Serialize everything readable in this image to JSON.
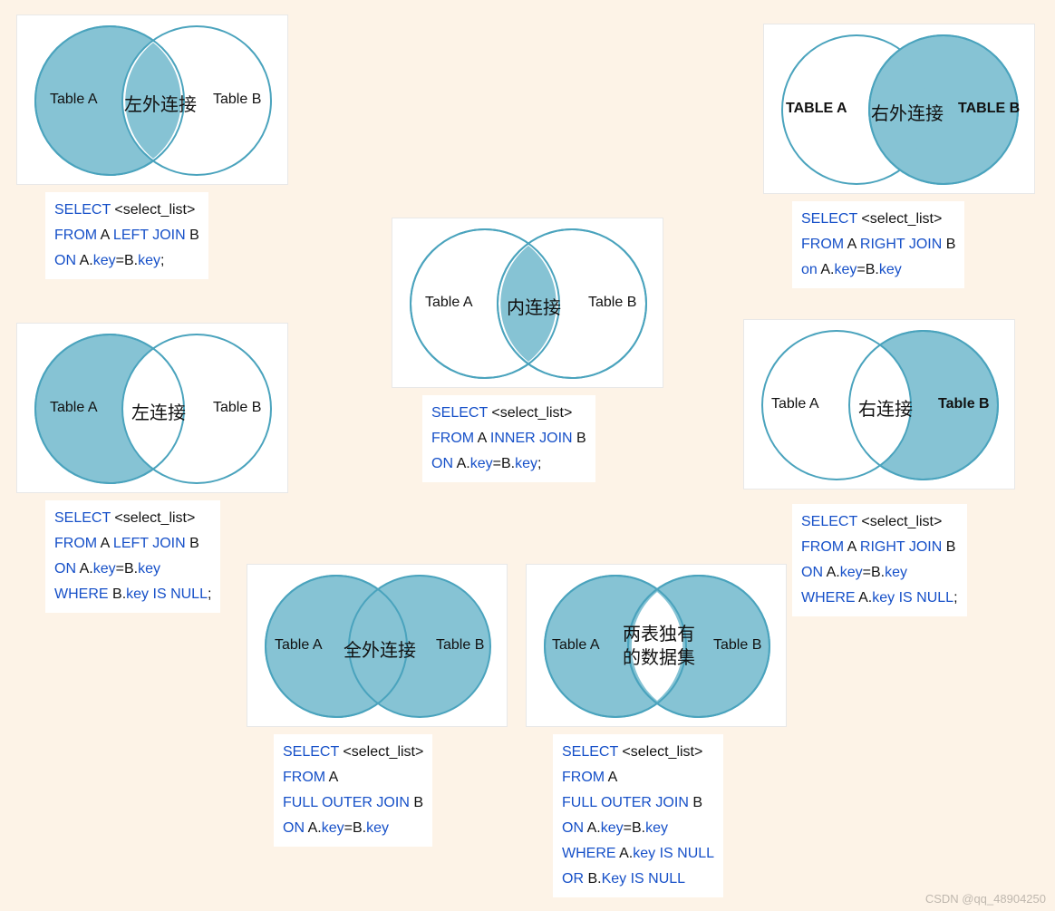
{
  "colors": {
    "fill": "#86c3d4",
    "stroke": "#4aa3bd",
    "white": "#ffffff"
  },
  "watermark": "CSDN @qq_48904250",
  "diagrams": {
    "left_outer": {
      "title": "左外连接",
      "labelA": "Table A",
      "labelB": "Table B",
      "sql": {
        "l1": {
          "select": "SELECT",
          "args": "<select_list>"
        },
        "l2": {
          "from": "FROM",
          "a": "A",
          "join": "LEFT JOIN",
          "b": "B"
        },
        "l3": {
          "on": "ON",
          "ak": "A.",
          "key1": "key",
          "eq": "=B.",
          "key2": "key",
          "semi": ";"
        }
      }
    },
    "right_outer": {
      "title": "右外连接",
      "labelA": "TABLE A",
      "labelB": "TABLE B",
      "sql": {
        "l1": {
          "select": "SELECT",
          "args": "<select_list>"
        },
        "l2": {
          "from": "FROM",
          "a": "A",
          "join": "RIGHT JOIN",
          "b": "B"
        },
        "l3": {
          "on": "on",
          "ak": "A.",
          "key1": "key",
          "eq": "=B.",
          "key2": "key"
        }
      }
    },
    "inner": {
      "title": "内连接",
      "labelA": "Table A",
      "labelB": "Table B",
      "sql": {
        "l1": {
          "select": "SELECT",
          "args": "<select_list>"
        },
        "l2": {
          "from": "FROM",
          "a": "A",
          "join": "INNER JOIN",
          "b": "B"
        },
        "l3": {
          "on": "ON",
          "ak": "A.",
          "key1": "key",
          "eq": "=B.",
          "key2": "key",
          "semi": ";"
        }
      }
    },
    "left_only": {
      "title": "左连接",
      "labelA": "Table A",
      "labelB": "Table B",
      "sql": {
        "l1": {
          "select": "SELECT",
          "args": "<select_list>"
        },
        "l2": {
          "from": "FROM",
          "a": "A",
          "join": "LEFT JOIN",
          "b": "B"
        },
        "l3": {
          "on": "ON",
          "ak": "A.",
          "key1": "key",
          "eq": "=B.",
          "key2": "key"
        },
        "l4": {
          "where": "WHERE",
          "b": "B.",
          "key": "key",
          "isnull": "IS NULL",
          "semi": ";"
        }
      }
    },
    "right_only": {
      "title": "右连接",
      "labelA": "Table A",
      "labelB": "Table B",
      "sql": {
        "l1": {
          "select": "SELECT",
          "args": "<select_list>"
        },
        "l2": {
          "from": "FROM",
          "a": "A",
          "join": "RIGHT JOIN",
          "b": "B"
        },
        "l3": {
          "on": "ON",
          "ak": "A.",
          "key1": "key",
          "eq": "=B.",
          "key2": "key"
        },
        "l4": {
          "where": "WHERE",
          "a": "A.",
          "key": "key",
          "isnull": "IS NULL",
          "semi": ";"
        }
      }
    },
    "full_outer": {
      "title": "全外连接",
      "labelA": "Table A",
      "labelB": "Table B",
      "sql": {
        "l1": {
          "select": "SELECT",
          "args": "<select_list>"
        },
        "l2": {
          "from": "FROM",
          "a": "A"
        },
        "l3": {
          "join": "FULL OUTER JOIN",
          "b": "B"
        },
        "l4": {
          "on": "ON",
          "ak": "A.",
          "key1": "key",
          "eq": "=B.",
          "key2": "key"
        }
      }
    },
    "full_excl": {
      "title_l1": "两表独有",
      "title_l2": "的数据集",
      "labelA": "Table A",
      "labelB": "Table B",
      "sql": {
        "l1": {
          "select": "SELECT",
          "args": "<select_list>"
        },
        "l2": {
          "from": "FROM",
          "a": "A"
        },
        "l3": {
          "join": "FULL OUTER JOIN",
          "b": "B"
        },
        "l4": {
          "on": "ON",
          "ak": "A.",
          "key1": "key",
          "eq": "=B.",
          "key2": "key"
        },
        "l5": {
          "where": "WHERE",
          "a": "A.",
          "key": "key",
          "isnull": "IS NULL"
        },
        "l6": {
          "or": "OR",
          "b": "B.",
          "key": "Key",
          "isnull": "IS NULL"
        }
      }
    }
  }
}
